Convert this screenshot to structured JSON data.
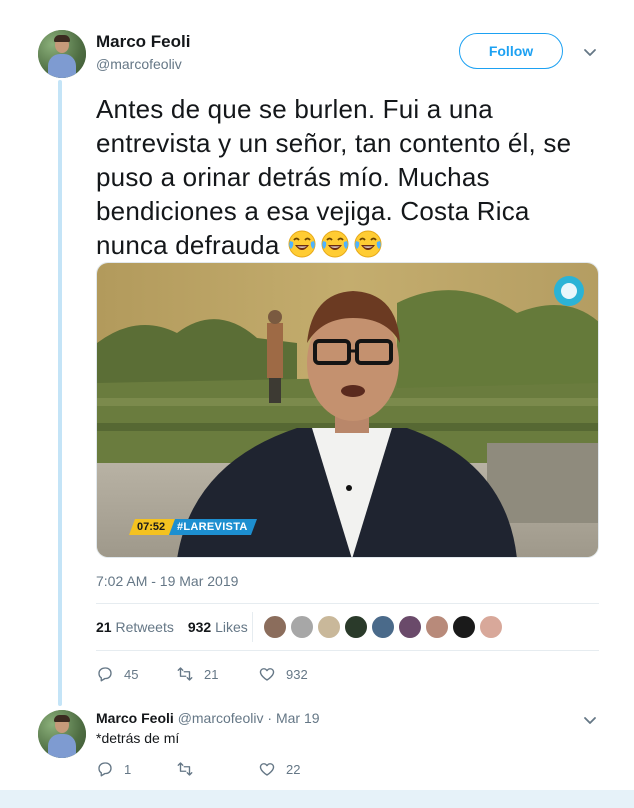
{
  "tweet": {
    "author_name": "Marco Feoli",
    "author_handle": "@marcofeoliv",
    "follow_label": "Follow",
    "text": "Antes de que se burlen. Fui a una entrevista y un señor, tan contento él, se puso a orinar detrás mío. Muchas bendiciones a esa vejiga. Costa Rica nunca defrauda",
    "emojis": [
      "face-with-tears-of-joy",
      "face-with-tears-of-joy",
      "face-with-tears-of-joy"
    ],
    "media": {
      "clock": "07:52",
      "hashtag": "#LAREVISTA"
    },
    "timestamp": "7:02 AM - 19 Mar 2019",
    "retweets_count": "21",
    "retweets_label": "Retweets",
    "likes_count": "932",
    "likes_label": "Likes",
    "actions": {
      "replies": "45",
      "retweets": "21",
      "likes": "932"
    }
  },
  "reply": {
    "author_name": "Marco Feoli",
    "author_handle": "@marcofeoliv",
    "separator": "·",
    "date": "Mar 19",
    "text": "*detrás de mí",
    "actions": {
      "replies": "1",
      "retweets": "",
      "likes": "22"
    }
  },
  "colors": {
    "accent": "#1da1f2",
    "secondary_text": "#657786",
    "thread_line": "#c4e4f7"
  }
}
